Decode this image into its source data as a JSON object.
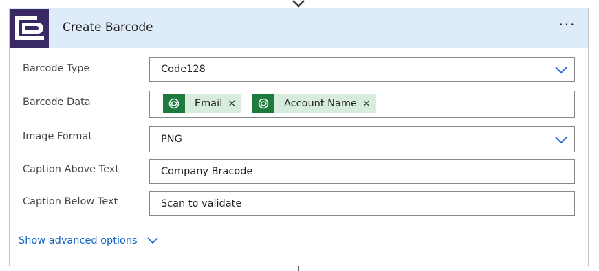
{
  "card": {
    "title": "Create Barcode",
    "more_label": "···"
  },
  "fields": {
    "barcode_type": {
      "label": "Barcode Type",
      "value": "Code128"
    },
    "barcode_data": {
      "label": "Barcode Data",
      "tokens": [
        {
          "label": "Email",
          "remove": "×"
        },
        {
          "label": "Account Name",
          "remove": "×"
        }
      ]
    },
    "image_format": {
      "label": "Image Format",
      "value": "PNG"
    },
    "caption_above": {
      "label": "Caption Above Text",
      "value": "Company Bracode"
    },
    "caption_below": {
      "label": "Caption Below Text",
      "value": "Scan to validate"
    }
  },
  "advanced": {
    "label": "Show advanced options"
  },
  "colors": {
    "header_bg": "#deecf9",
    "logo_bg": "#3a2a64",
    "token_bg": "#d8ecde",
    "token_icon_bg": "#1f7a3e",
    "link": "#0f62c5"
  }
}
